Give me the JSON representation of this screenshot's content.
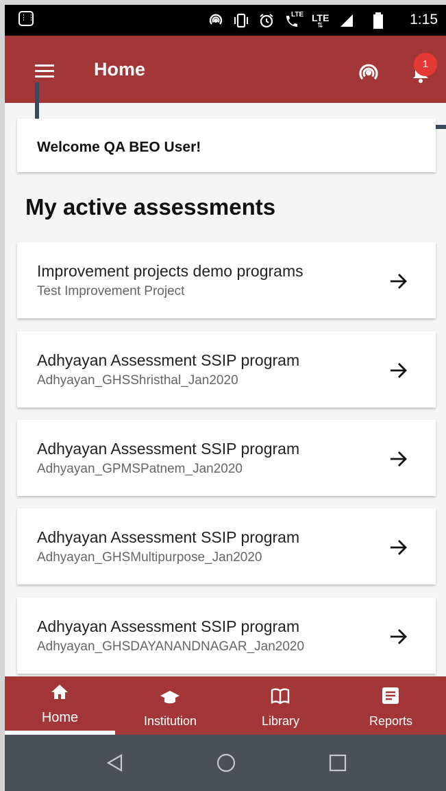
{
  "status_bar": {
    "time": "1:15",
    "icons": [
      "keyboard-icon",
      "hotspot-icon",
      "vibrate-icon",
      "alarm-icon",
      "volte-call-icon",
      "lte-icon",
      "signal-icon",
      "battery-icon"
    ],
    "lte_label": "LTE"
  },
  "app_bar": {
    "title": "Home",
    "notification_count": "1",
    "color": "#a33737"
  },
  "welcome": {
    "text": "Welcome QA BEO User!"
  },
  "section_title": "My active assessments",
  "assessments": [
    {
      "title": "Improvement projects demo programs",
      "subtitle": "Test Improvement Project"
    },
    {
      "title": "Adhyayan Assessment SSIP program",
      "subtitle": "Adhyayan_GHSShristhal_Jan2020"
    },
    {
      "title": "Adhyayan Assessment SSIP program",
      "subtitle": "Adhyayan_GPMSPatnem_Jan2020"
    },
    {
      "title": "Adhyayan Assessment SSIP program",
      "subtitle": "Adhyayan_GHSMultipurpose_Jan2020"
    },
    {
      "title": "Adhyayan Assessment SSIP program",
      "subtitle": "Adhyayan_GHSDAYANANDNAGAR_Jan2020"
    }
  ],
  "bottom_nav": [
    {
      "label": "Home",
      "icon": "home-icon",
      "active": true
    },
    {
      "label": "Institution",
      "icon": "graduation-cap-icon",
      "active": false
    },
    {
      "label": "Library",
      "icon": "book-icon",
      "active": false
    },
    {
      "label": "Reports",
      "icon": "report-icon",
      "active": false
    }
  ]
}
